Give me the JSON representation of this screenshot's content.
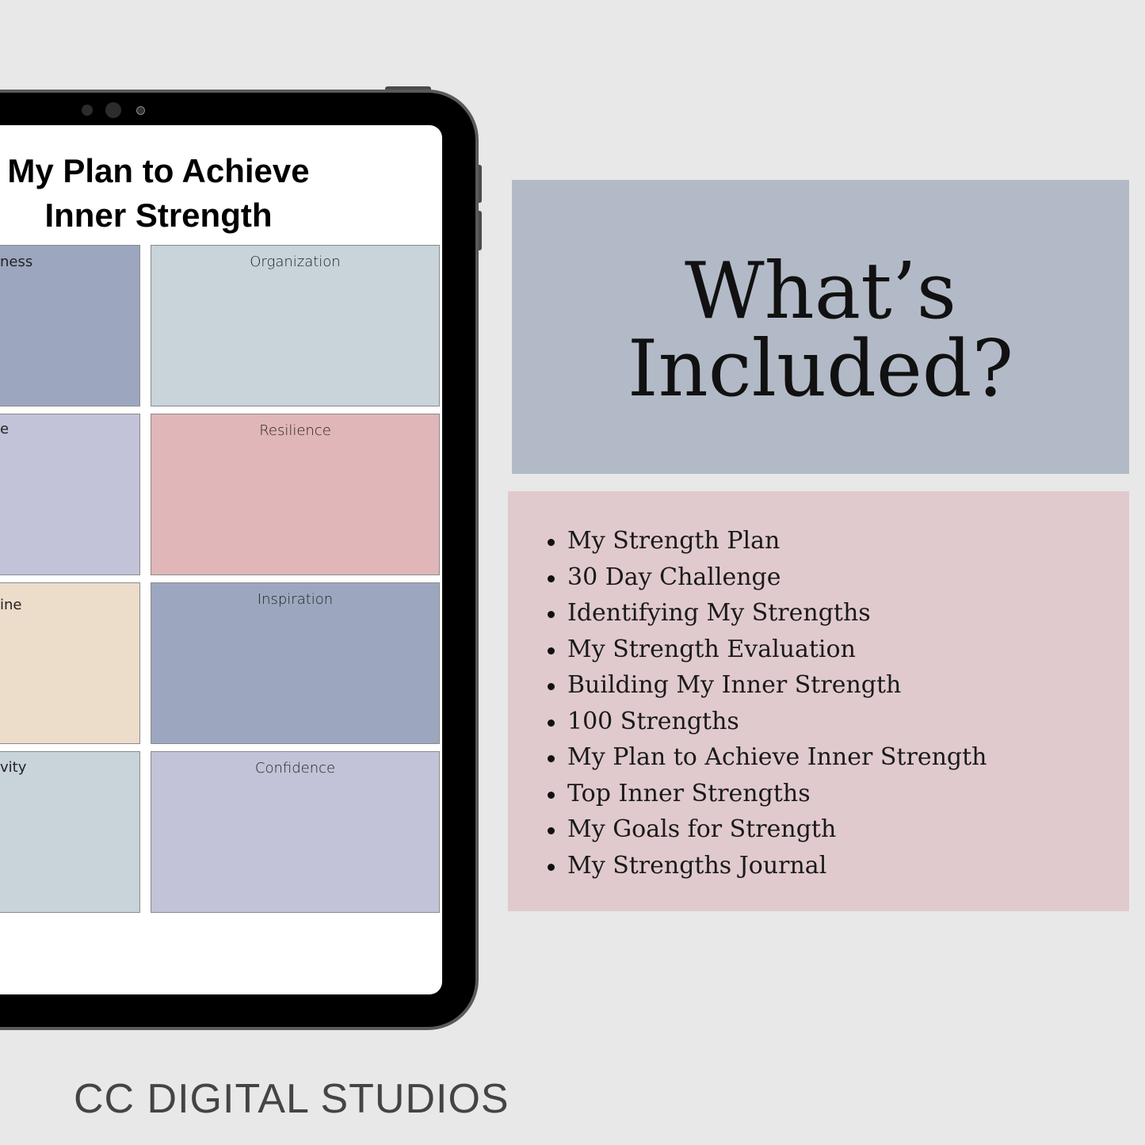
{
  "tablet": {
    "title_line1": "My Plan to Achieve",
    "title_line2": "Inner Strength",
    "left_fragments": [
      "ness",
      "e",
      "ine",
      "vity"
    ],
    "boxes": [
      {
        "label": "Organization",
        "color": "#c8d3da"
      },
      {
        "label": "Resilience",
        "color": "#e0b6b8"
      },
      {
        "label": "Inspiration",
        "color": "#9ca7bf"
      },
      {
        "label": "Confidence",
        "color": "#c2c3d8"
      }
    ],
    "left_colors": [
      "#9ca7bf",
      "#c2c3d8",
      "#ecdcca",
      "#c8d3da"
    ]
  },
  "heading": {
    "line1": "What’s",
    "line2": "Included?"
  },
  "included": [
    "My Strength Plan",
    "30 Day Challenge",
    "Identifying My Strengths",
    "My Strength Evaluation",
    "Building My Inner Strength",
    "100 Strengths",
    "My Plan to Achieve Inner Strength",
    "Top Inner Strengths",
    "My Goals for Strength",
    "My Strengths Journal"
  ],
  "footer": "CC DIGITAL STUDIOS"
}
